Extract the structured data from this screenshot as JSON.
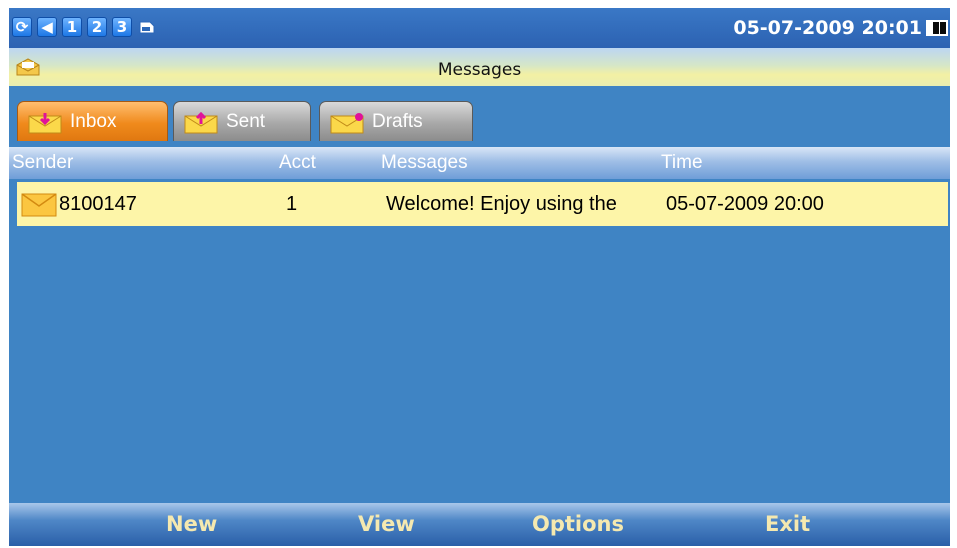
{
  "status_bar": {
    "icons": [
      {
        "name": "sync-icon",
        "text": "⟳"
      },
      {
        "name": "volume-icon",
        "text": "◀"
      },
      {
        "name": "account-1-icon",
        "text": "1"
      },
      {
        "name": "account-2-icon",
        "text": "2"
      },
      {
        "name": "account-3-icon",
        "text": "3"
      },
      {
        "name": "sim-card-icon",
        "text": ""
      }
    ],
    "datetime": "05-07-2009 20:01",
    "battery_icon": "battery-icon"
  },
  "title_bar": {
    "title": "Messages",
    "icon": "mail-icon"
  },
  "tabs": [
    {
      "label": "Inbox",
      "active": true,
      "icon": "inbox-icon"
    },
    {
      "label": "Sent",
      "active": false,
      "icon": "sent-icon"
    },
    {
      "label": "Drafts",
      "active": false,
      "icon": "drafts-icon"
    }
  ],
  "columns": {
    "sender": "Sender",
    "acct": "Acct",
    "messages": "Messages",
    "time": "Time"
  },
  "rows": [
    {
      "sender": "8100147",
      "acct": "1",
      "message": "Welcome! Enjoy using the",
      "time": "05-07-2009 20:00",
      "icon": "envelope-icon"
    }
  ],
  "softkeys": {
    "new": "New",
    "view": "View",
    "options": "Options",
    "exit": "Exit"
  },
  "colors": {
    "background": "#3f84c4",
    "selected_row": "#fdf5a8",
    "active_tab": "#f08a1c",
    "softkey_text": "#f5e9b0"
  }
}
